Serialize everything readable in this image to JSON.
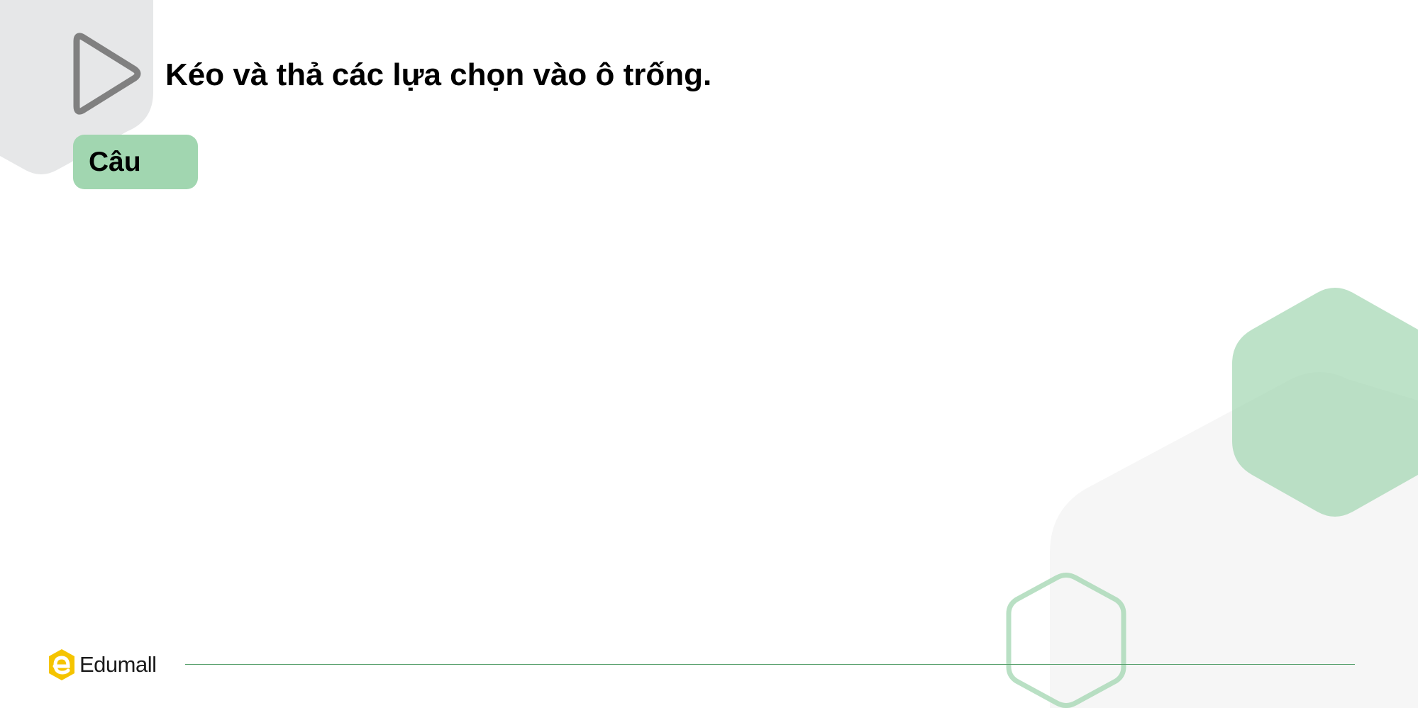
{
  "slide": {
    "title": "Kéo và thả các lựa chọn vào ô trống.",
    "question_label": "Câu"
  },
  "footer": {
    "brand": "Edumall"
  },
  "icons": {
    "play": "play-icon",
    "brand_logo": "edumall-logo-icon"
  },
  "colors": {
    "accent_green": "#a1d6b0",
    "footer_line": "#57a06c",
    "logo_yellow": "#f5c400",
    "decor_gray": "#e6e7e8"
  }
}
